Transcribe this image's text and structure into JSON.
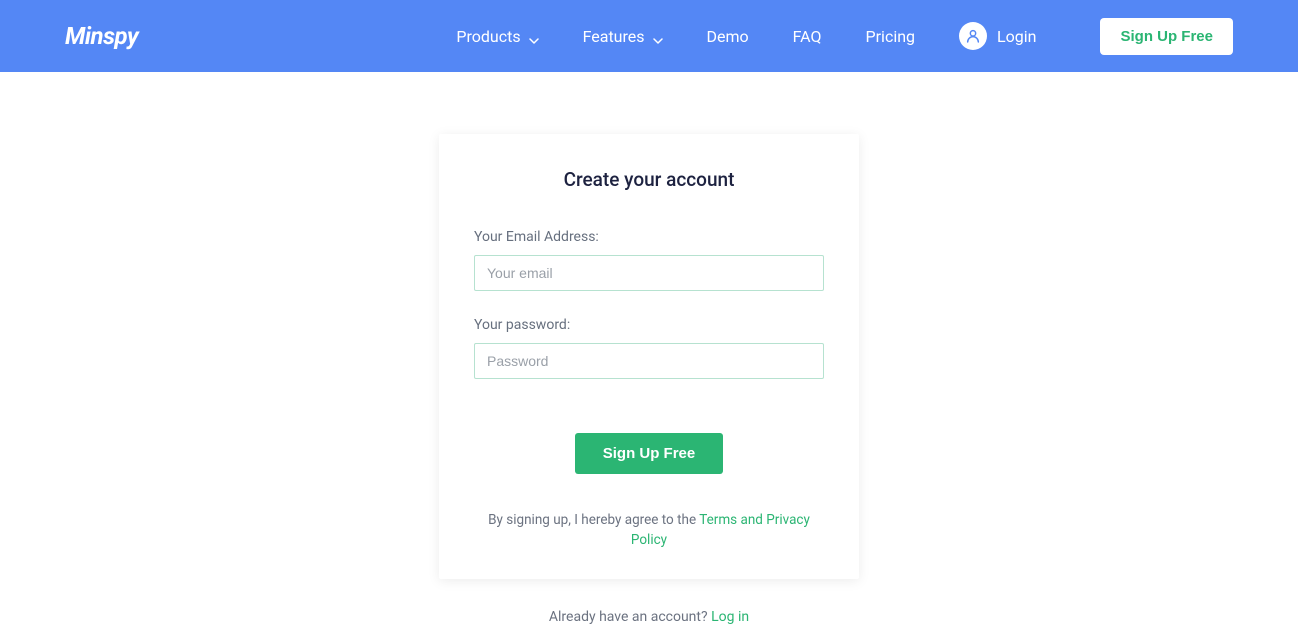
{
  "brand": "Minspy",
  "nav": {
    "products": "Products",
    "features": "Features",
    "demo": "Demo",
    "faq": "FAQ",
    "pricing": "Pricing",
    "login": "Login",
    "signup": "Sign Up Free"
  },
  "form": {
    "title": "Create your account",
    "email_label": "Your Email Address:",
    "email_placeholder": "Your email",
    "password_label": "Your password:",
    "password_placeholder": "Password",
    "submit": "Sign Up Free",
    "agree_prefix": "By signing up, I hereby agree to the ",
    "agree_link": "Terms and Privacy Policy"
  },
  "already": {
    "text": "Already have an account? ",
    "link": "Log in"
  }
}
